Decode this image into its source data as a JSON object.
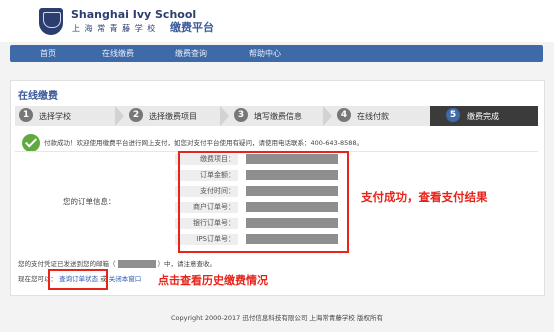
{
  "header": {
    "school_name_en": "Shanghai Ivy School",
    "school_name_cn": "上 海 常 青 藤 学 校",
    "platform_title": "缴费平台"
  },
  "nav": {
    "items": [
      "首页",
      "在线缴费",
      "缴费查询",
      "帮助中心"
    ]
  },
  "panel": {
    "title": "在线缴费",
    "steps": [
      {
        "num": "1",
        "label": "选择学校"
      },
      {
        "num": "2",
        "label": "选择缴费项目"
      },
      {
        "num": "3",
        "label": "填写缴费信息"
      },
      {
        "num": "4",
        "label": "在线付款"
      },
      {
        "num": "5",
        "label": "缴费完成"
      }
    ],
    "success_message": "付款成功！欢迎使用缴费平台进行网上支付，如您对支付平台使用有疑问，请使用电话联系：400-643-8588。",
    "order_info_label": "您的订单信息：",
    "order_fields": [
      "缴费项目：",
      "订单金额：",
      "支付时间：",
      "商户订单号：",
      "银行订单号：",
      "IPS订单号："
    ],
    "email_prefix": "您的支付凭证已发送到您的邮箱（",
    "email_suffix": "）中，请注意查收。",
    "now_prefix": "现在您可以：",
    "view_order_link": "查询订单状态",
    "or_text": "或",
    "close_window_link": "关闭本窗口"
  },
  "annotations": {
    "payment_success": "支付成功，查看支付结果",
    "view_history": "点击查看历史缴费情况"
  },
  "footer": {
    "copyright": "Copyright 2000-2017 迅付信息科技有限公司  上海常青藤学校 版权所有"
  },
  "colors": {
    "brand_blue": "#3f6aa8",
    "annotation_red": "#e8231a",
    "success_green": "#61a93f"
  }
}
